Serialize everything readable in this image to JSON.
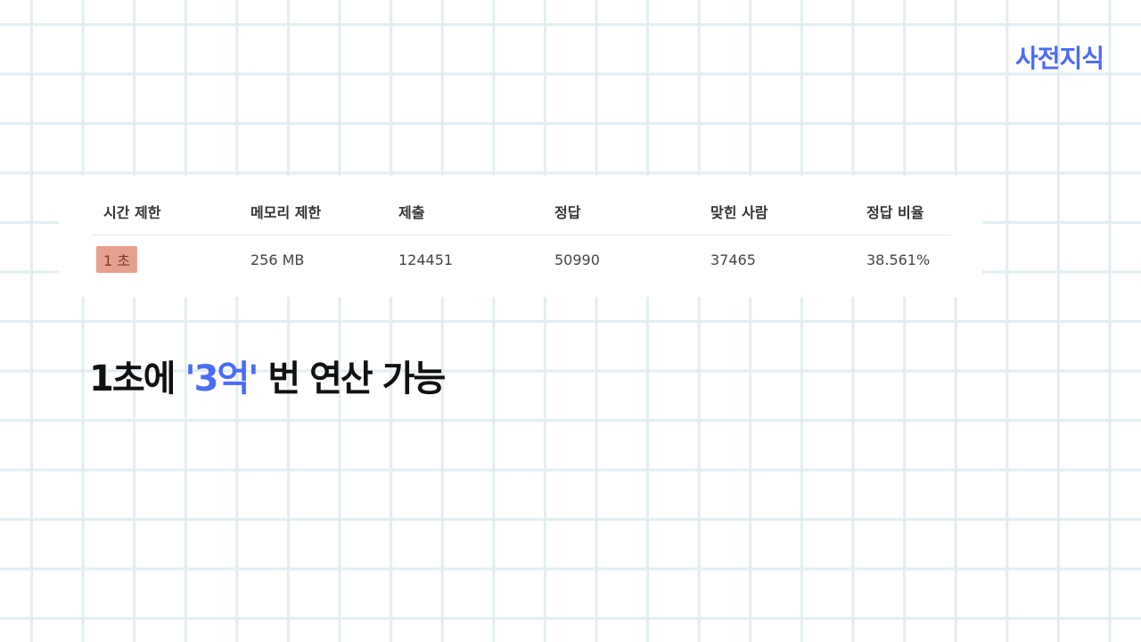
{
  "brand": "사전지식",
  "table": {
    "headers": [
      "시간 제한",
      "메모리 제한",
      "제출",
      "정답",
      "맞힌 사람",
      "정답 비율"
    ],
    "row": [
      "1 초",
      "256 MB",
      "124451",
      "50990",
      "37465",
      "38.561%"
    ]
  },
  "headline": {
    "prefix": "1초에 ",
    "highlight": "'3억'",
    "suffix": " 번 연산 가능"
  },
  "colors": {
    "accent": "#4a6cf7",
    "chip": "#e8a08e",
    "grid": "#e3eef2"
  }
}
